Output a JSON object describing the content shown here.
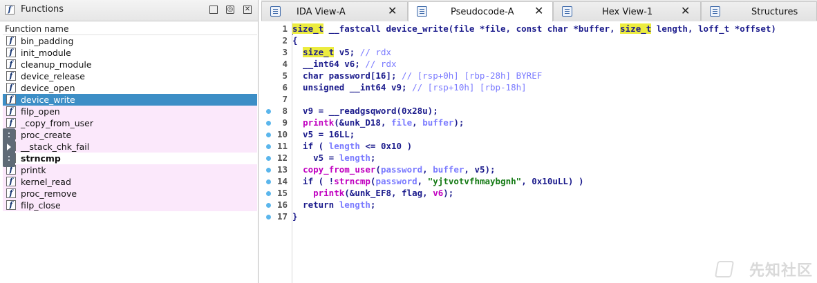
{
  "functions_pane": {
    "title": "Functions",
    "icon": "function-icon",
    "column_header": "Function name",
    "rows": [
      {
        "name": "bin_padding",
        "style": "normal"
      },
      {
        "name": "init_module",
        "style": "normal"
      },
      {
        "name": "cleanup_module",
        "style": "normal"
      },
      {
        "name": "device_release",
        "style": "normal"
      },
      {
        "name": "device_open",
        "style": "normal"
      },
      {
        "name": "device_write",
        "style": "selected"
      },
      {
        "name": "filp_open",
        "style": "import"
      },
      {
        "name": "_copy_from_user",
        "style": "import"
      },
      {
        "name": "proc_create",
        "style": "import"
      },
      {
        "name": "__stack_chk_fail",
        "style": "import"
      },
      {
        "name": "strncmp",
        "style": "bold"
      },
      {
        "name": "printk",
        "style": "import"
      },
      {
        "name": "kernel_read",
        "style": "import"
      },
      {
        "name": "proc_remove",
        "style": "import"
      },
      {
        "name": "filp_close",
        "style": "import"
      }
    ],
    "function_glyph": "f",
    "colors": {
      "selected": "#3c8ec6",
      "import": "#fbe8fb"
    }
  },
  "tabs": [
    {
      "label": "IDA View-A",
      "icon": "disassembly-icon",
      "active": false
    },
    {
      "label": "Pseudocode-A",
      "icon": "pseudocode-icon",
      "active": true
    },
    {
      "label": "Hex View-1",
      "icon": "hex-view-icon",
      "active": false
    },
    {
      "label": "Structures",
      "icon": "structures-icon",
      "active": false
    }
  ],
  "close_glyph": "✕",
  "pseudocode": {
    "lines": [
      {
        "n": "1",
        "bp": false,
        "tokens": [
          [
            "hl",
            "size_t"
          ],
          [
            "pl",
            " __fastcall device_write(file *file, const char *buffer, "
          ],
          [
            "hl",
            "size_t"
          ],
          [
            "pl",
            " length, loff_t *offset)"
          ]
        ]
      },
      {
        "n": "2",
        "bp": false,
        "tokens": [
          [
            "pl",
            "{"
          ]
        ]
      },
      {
        "n": "3",
        "bp": false,
        "tokens": [
          [
            "pl",
            "  "
          ],
          [
            "hl",
            "size_t"
          ],
          [
            "pl",
            " v5; "
          ],
          [
            "cm",
            "// rdx"
          ]
        ]
      },
      {
        "n": "4",
        "bp": false,
        "tokens": [
          [
            "pl",
            "  __int64 v6; "
          ],
          [
            "cm",
            "// rdx"
          ]
        ]
      },
      {
        "n": "5",
        "bp": false,
        "tokens": [
          [
            "pl",
            "  char password[16]; "
          ],
          [
            "cm",
            "// [rsp+0h] [rbp-28h] BYREF"
          ]
        ]
      },
      {
        "n": "6",
        "bp": false,
        "tokens": [
          [
            "pl",
            "  unsigned __int64 v9; "
          ],
          [
            "cm",
            "// [rsp+10h] [rbp-18h]"
          ]
        ]
      },
      {
        "n": "7",
        "bp": false,
        "tokens": [
          [
            "pl",
            ""
          ]
        ]
      },
      {
        "n": "8",
        "bp": true,
        "tokens": [
          [
            "pl",
            "  v9 = __readgsqword(0x28u);"
          ]
        ]
      },
      {
        "n": "9",
        "bp": true,
        "tokens": [
          [
            "pl",
            "  "
          ],
          [
            "fn",
            "printk"
          ],
          [
            "pl",
            "(&unk_D18, "
          ],
          [
            "var",
            "file"
          ],
          [
            "pl",
            ", "
          ],
          [
            "var",
            "buffer"
          ],
          [
            "pl",
            ");"
          ]
        ]
      },
      {
        "n": "10",
        "bp": true,
        "tokens": [
          [
            "pl",
            "  v5 = 16LL;"
          ]
        ]
      },
      {
        "n": "11",
        "bp": true,
        "tokens": [
          [
            "pl",
            "  if ( "
          ],
          [
            "var",
            "length"
          ],
          [
            "pl",
            " <= 0x10 )"
          ]
        ]
      },
      {
        "n": "12",
        "bp": true,
        "tokens": [
          [
            "pl",
            "    v5 = "
          ],
          [
            "var",
            "length"
          ],
          [
            "pl",
            ";"
          ]
        ]
      },
      {
        "n": "13",
        "bp": true,
        "tokens": [
          [
            "pl",
            "  "
          ],
          [
            "fn",
            "copy_from_user"
          ],
          [
            "pl",
            "("
          ],
          [
            "var",
            "password"
          ],
          [
            "pl",
            ", "
          ],
          [
            "var",
            "buffer"
          ],
          [
            "pl",
            ", v5);"
          ]
        ]
      },
      {
        "n": "14",
        "bp": true,
        "tokens": [
          [
            "pl",
            "  if ( !"
          ],
          [
            "fn",
            "strncmp"
          ],
          [
            "pl",
            "("
          ],
          [
            "var",
            "password"
          ],
          [
            "pl",
            ", "
          ],
          [
            "str",
            "\"yjtvotvfhmaybgnh\""
          ],
          [
            "pl",
            ", 0x10uLL) )"
          ]
        ]
      },
      {
        "n": "15",
        "bp": true,
        "tokens": [
          [
            "pl",
            "    "
          ],
          [
            "fn",
            "printk"
          ],
          [
            "pl",
            "(&unk_EF8, flag, "
          ],
          [
            "fn",
            "v6"
          ],
          [
            "pl",
            ");"
          ]
        ]
      },
      {
        "n": "16",
        "bp": true,
        "tokens": [
          [
            "pl",
            "  return "
          ],
          [
            "var",
            "length"
          ],
          [
            "pl",
            ";"
          ]
        ]
      },
      {
        "n": "17",
        "bp": true,
        "tokens": [
          [
            "pl",
            "}"
          ]
        ]
      }
    ]
  },
  "watermark": "先知社区"
}
